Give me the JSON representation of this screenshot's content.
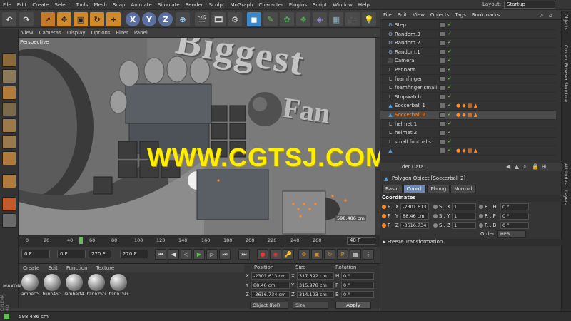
{
  "menubar": {
    "items": [
      "File",
      "Edit",
      "Create",
      "Select",
      "Tools",
      "Mesh",
      "Snap",
      "Animate",
      "Simulate",
      "Render",
      "Sculpt",
      "MoGraph",
      "Character",
      "Plugins",
      "Script",
      "Window",
      "Help"
    ],
    "layout_label": "Layout:",
    "layout_value": "Startup"
  },
  "toolbar": {
    "axis_x": "X",
    "axis_y": "Y",
    "axis_z": "Z"
  },
  "viewport": {
    "menu": [
      "View",
      "Cameras",
      "Display",
      "Options",
      "Filter",
      "Panel"
    ],
    "camera_label": "Perspective",
    "scene_text_1": "Biggest",
    "scene_text_2": "Fan",
    "distance_readout": "598.486 cm"
  },
  "watermark": "WWW.CGTSJ.COM",
  "timeline": {
    "ticks": [
      "0",
      "20",
      "40",
      "48",
      "60",
      "80",
      "100",
      "120",
      "140",
      "160",
      "180",
      "200",
      "220",
      "240",
      "260"
    ],
    "current_frame_marker": "48",
    "end_frame_display": "48 F",
    "start_field": "0 F",
    "current_field": "0 F",
    "end_field": "270 F",
    "end_field2": "270 F"
  },
  "materials": {
    "menu": [
      "Create",
      "Edit",
      "Function",
      "Texture"
    ],
    "items": [
      "lambert5",
      "blinn4SG",
      "lambert4",
      "blinn2SG",
      "blinn1SG"
    ],
    "logo_top": "MAXON",
    "logo_bottom": "CINEMA 4D"
  },
  "coordinates_manager": {
    "col_position": "Position",
    "col_size": "Size",
    "col_rotation": "Rotation",
    "rows": [
      {
        "axis": "X",
        "pos": "-2301.613 cm",
        "size": "317.392 cm",
        "rot_label": "H",
        "rot": "0 °"
      },
      {
        "axis": "Y",
        "pos": "88.46 cm",
        "size": "315.978 cm",
        "rot_label": "P",
        "rot": "0 °"
      },
      {
        "axis": "Z",
        "pos": "-3616.734 cm",
        "size": "314.193 cm",
        "rot_label": "B",
        "rot": "0 °"
      }
    ],
    "mode_select": "Object (Rel)",
    "size_select": "Size",
    "apply_label": "Apply"
  },
  "object_manager": {
    "menu": [
      "File",
      "Edit",
      "View",
      "Objects",
      "Tags",
      "Bookmarks"
    ],
    "objects": [
      {
        "name": "Step",
        "type": "mograph",
        "tags": "",
        "selected": false
      },
      {
        "name": "Random.3",
        "type": "mograph",
        "tags": "",
        "selected": false
      },
      {
        "name": "Random.2",
        "type": "mograph",
        "tags": "",
        "selected": false
      },
      {
        "name": "Random.1",
        "type": "mograph",
        "tags": "",
        "selected": false
      },
      {
        "name": "Camera",
        "type": "camera",
        "tags": "",
        "selected": false
      },
      {
        "name": "Pennant",
        "type": "null",
        "tags": "",
        "selected": false
      },
      {
        "name": "foamfinger",
        "type": "null",
        "tags": "",
        "selected": false
      },
      {
        "name": "foamfinger small",
        "type": "null",
        "tags": "",
        "selected": false
      },
      {
        "name": "Stopwatch",
        "type": "null",
        "tags": "",
        "selected": false
      },
      {
        "name": "Soccerball 1",
        "type": "polygon",
        "tags": "● ◆ ▦ ▲",
        "selected": false
      },
      {
        "name": "Soccerball 2",
        "type": "polygon",
        "tags": "● ◆ ▦ ▲",
        "selected": true
      },
      {
        "name": "helmet 1",
        "type": "null",
        "tags": "",
        "selected": false
      },
      {
        "name": "helmet 2",
        "type": "null",
        "tags": "",
        "selected": false
      },
      {
        "name": "small footballs",
        "type": "null",
        "tags": "",
        "selected": false
      },
      {
        "name": "",
        "type": "polygon",
        "tags": "● ◆ ▦ ▲",
        "selected": false
      }
    ]
  },
  "side_tabs": [
    "Objects",
    "Content Browser",
    "Structure",
    "Attributes",
    "Layers"
  ],
  "attributes": {
    "header_fragment": "der Data",
    "title": "Polygon Object [Soccerball 2]",
    "tabs": [
      "Basic",
      "Coord.",
      "Phong",
      "Normal"
    ],
    "active_tab": "Coord.",
    "section": "Coordinates",
    "rows": [
      {
        "p_label": "P . X",
        "p_val": "-2301.613",
        "s_label": "S . X",
        "s_val": "1",
        "r_label": "R . H",
        "r_val": "0 °"
      },
      {
        "p_label": "P . Y",
        "p_val": "88.46 cm",
        "s_label": "S . Y",
        "s_val": "1",
        "r_label": "R . P",
        "r_val": "0 °"
      },
      {
        "p_label": "P . Z",
        "p_val": "-3616.734",
        "s_label": "S . Z",
        "s_val": "1",
        "r_label": "R . B",
        "r_val": "0 °"
      }
    ],
    "order_label": "Order",
    "order_value": "HPB",
    "freeze_label": "Freeze Transformation"
  },
  "status": {
    "text": "598.486 cm"
  },
  "colors": {
    "accent_blue": "#6b86b0",
    "watermark_yellow": "#ffee00",
    "tag_orange": "#ff8a2a",
    "check_green": "#7ed957"
  }
}
